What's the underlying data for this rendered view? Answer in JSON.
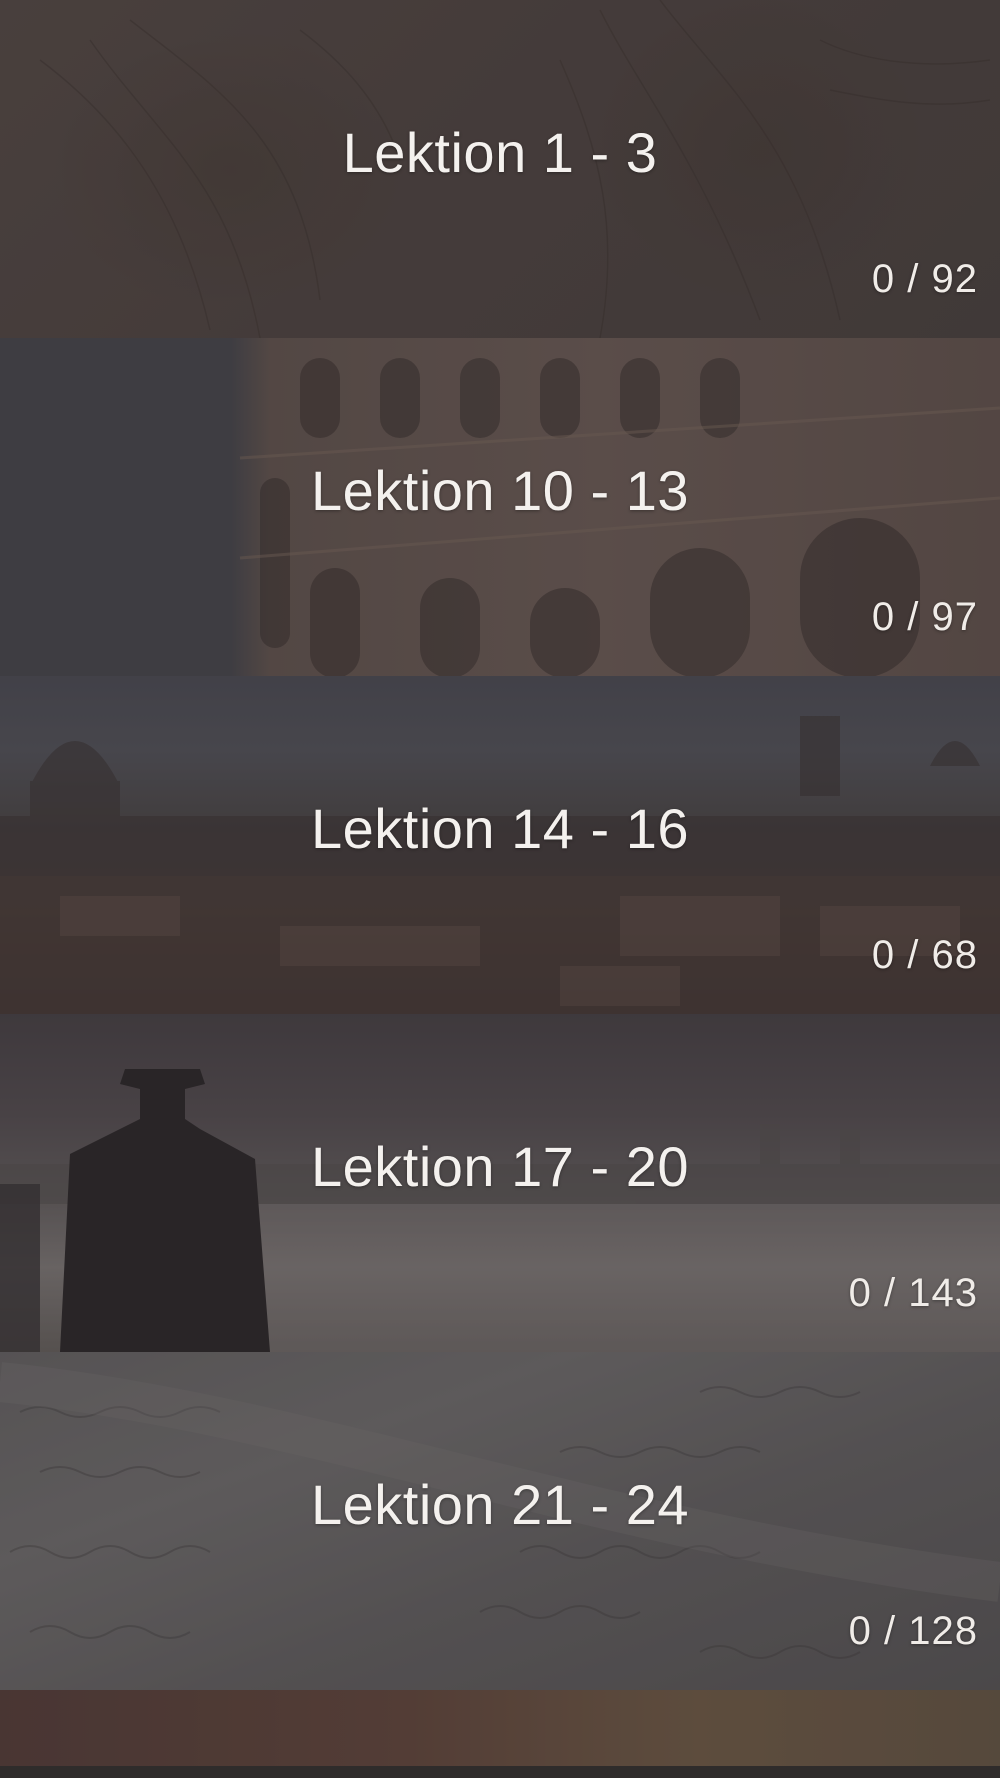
{
  "lessons": [
    {
      "title": "Lektion 1 - 3",
      "progress": "0 / 92"
    },
    {
      "title": "Lektion 10 - 13",
      "progress": "0 / 97"
    },
    {
      "title": "Lektion 14 - 16",
      "progress": "0 / 68"
    },
    {
      "title": "Lektion 17 - 20",
      "progress": "0 / 143"
    },
    {
      "title": "Lektion 21 - 24",
      "progress": "0 / 128"
    }
  ]
}
